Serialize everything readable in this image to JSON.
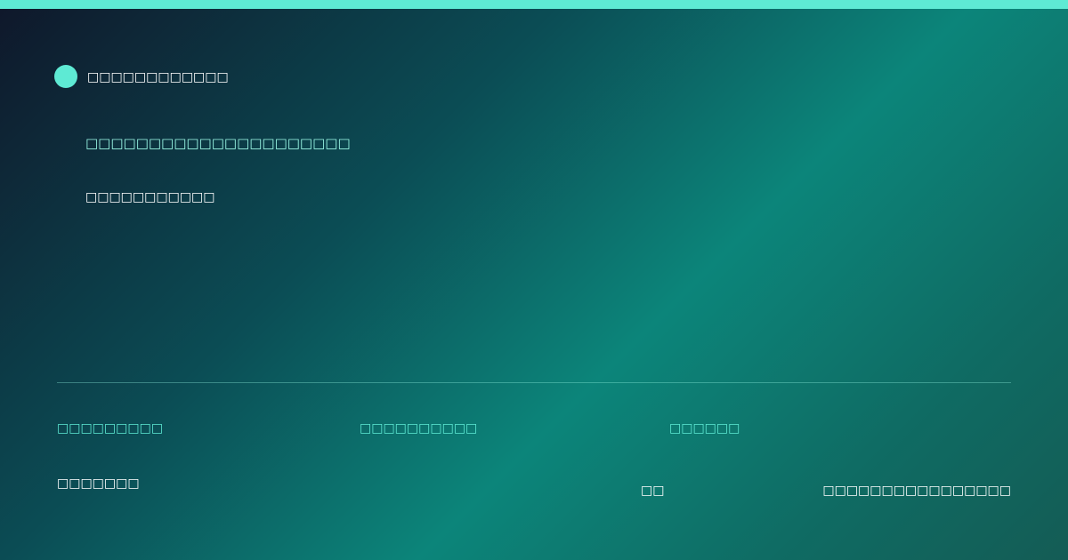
{
  "brand": {
    "name": "□□□□□□□□□□□□"
  },
  "hero": {
    "headline": "□□□□□□□□□□□□□□□□□□□□□",
    "subline": "□□□□□□□□□□□"
  },
  "footer": {
    "labels": [
      "□□□□□□□□□",
      "□□□□□□□□□□",
      "□□□□□□"
    ],
    "value": "□□□□□□□",
    "short": "□□",
    "right_text": "□□□□□□□□□□□□□□□□"
  },
  "colors": {
    "accent": "#5eead4",
    "accent_light": "#99f6e4",
    "background_start": "#0f172a",
    "background_mid": "#0c857a",
    "text": "#ffffff"
  }
}
